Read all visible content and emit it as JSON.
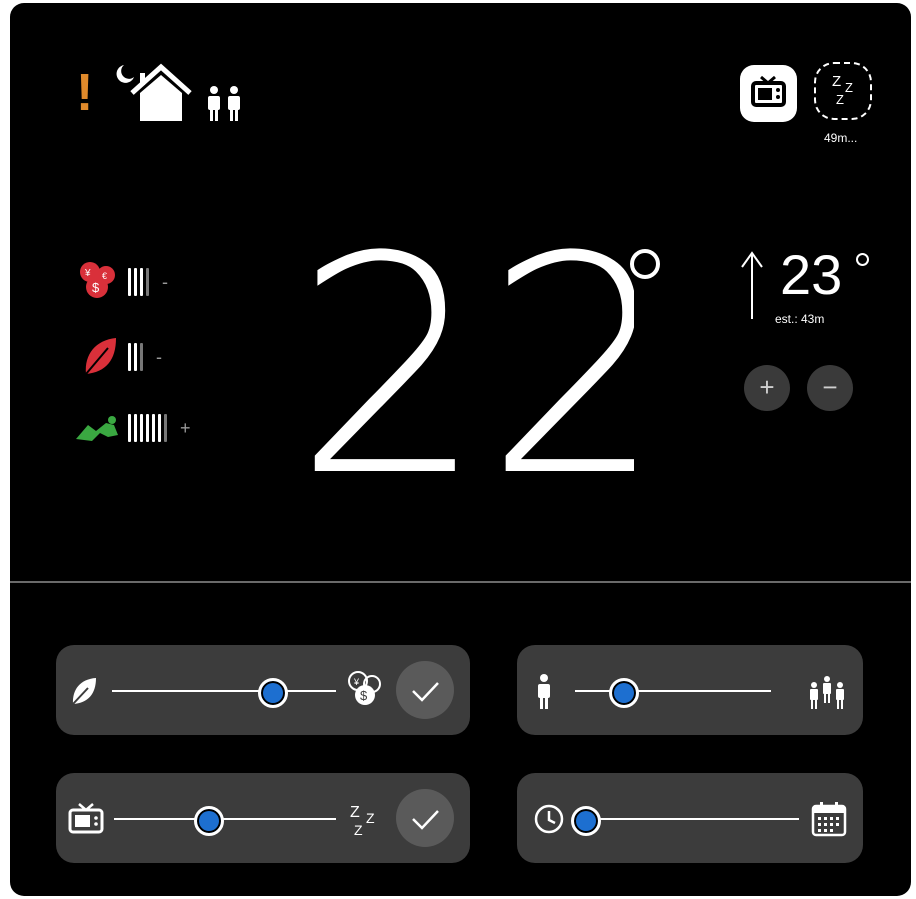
{
  "status": {
    "alert": "!",
    "mode_icons": [
      "moon-icon",
      "house-icon",
      "two-people-icon"
    ]
  },
  "top_right": {
    "tv_icon": "tv-icon",
    "sleep_icon": "zzz-icon",
    "sleep_timer": "49m..."
  },
  "current_temp": "22",
  "target": {
    "temp": "23",
    "est": "est.: 43m",
    "plus": "+",
    "minus": "−"
  },
  "metrics": [
    {
      "icon": "coins-icon",
      "bars_on": 4,
      "bars_total": 4,
      "sign": "-",
      "color": "#d9303a"
    },
    {
      "icon": "leaf-icon",
      "bars_on": 2,
      "bars_total": 3,
      "sign": "-",
      "color": "#d9303a"
    },
    {
      "icon": "lounge-icon",
      "bars_on": 6,
      "bars_total": 7,
      "sign": "+",
      "color": "#3aa841"
    }
  ],
  "sliders": [
    {
      "name": "eco-cost",
      "value": 0.72
    },
    {
      "name": "occupancy",
      "value": 0.25
    },
    {
      "name": "tv-sleep",
      "value": 0.43
    },
    {
      "name": "time-schedule",
      "value": 0.05
    }
  ],
  "colors": {
    "accent": "#1d6fd0",
    "alert": "#e08a2b",
    "panel": "#3c3c3c"
  }
}
